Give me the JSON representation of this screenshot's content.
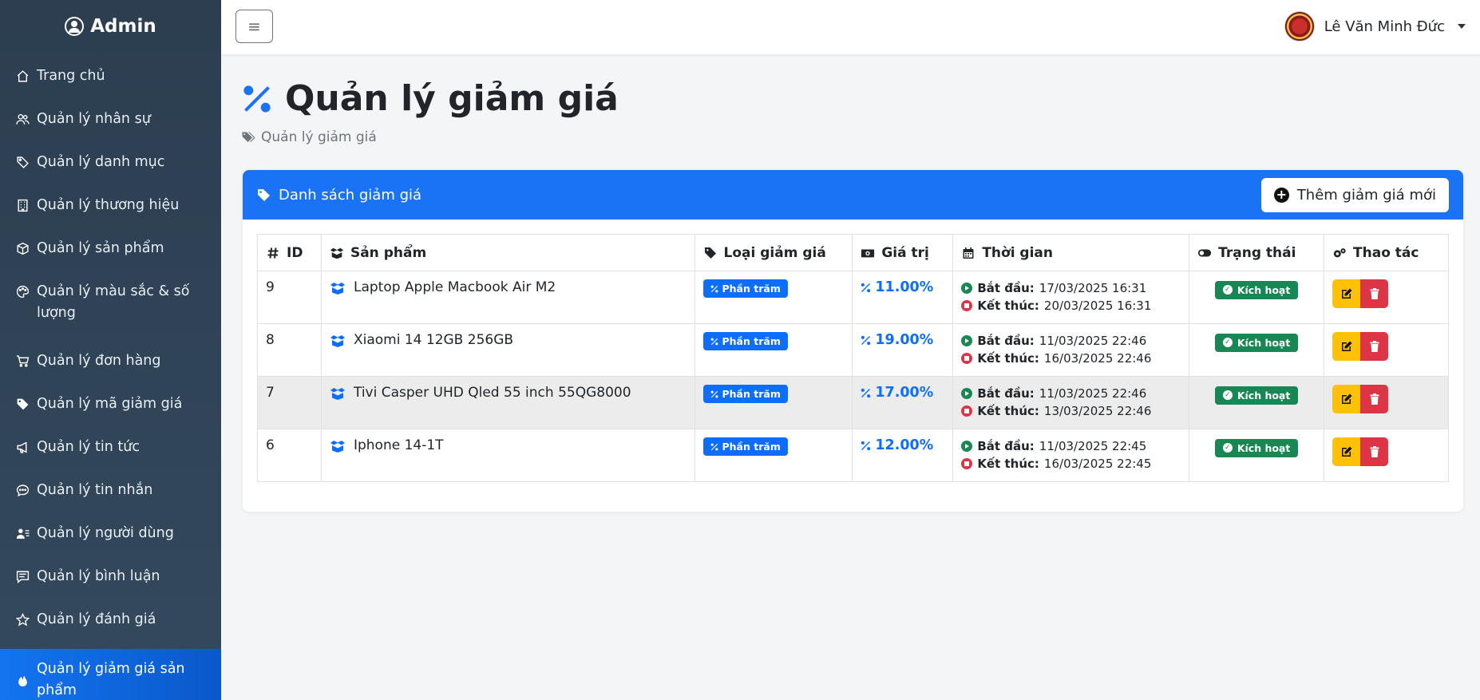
{
  "sidebar": {
    "brand": "Admin",
    "items": [
      {
        "label": "Trang chủ"
      },
      {
        "label": "Quản lý nhân sự"
      },
      {
        "label": "Quản lý danh mục"
      },
      {
        "label": "Quản lý thương hiệu"
      },
      {
        "label": "Quản lý sản phẩm"
      },
      {
        "label": "Quản lý màu sắc & số lượng"
      },
      {
        "label": "Quản lý đơn hàng"
      },
      {
        "label": "Quản lý mã giảm giá"
      },
      {
        "label": "Quản lý tin tức"
      },
      {
        "label": "Quản lý tin nhắn"
      },
      {
        "label": "Quản lý người dùng"
      },
      {
        "label": "Quản lý bình luận"
      },
      {
        "label": "Quản lý đánh giá"
      },
      {
        "label": "Quản lý giảm giá sản phẩm"
      }
    ],
    "active_index": 13
  },
  "header": {
    "toggle_label": "≡",
    "user_name": "Lê Văn Minh Đức"
  },
  "page": {
    "title": "Quản lý giảm giá",
    "breadcrumb": "Quản lý giảm giá"
  },
  "card": {
    "title": "Danh sách giảm giá",
    "add_button": "Thêm giảm giá mới"
  },
  "table": {
    "headers": {
      "id": "ID",
      "product": "Sản phẩm",
      "type": "Loại giảm giá",
      "value": "Giá trị",
      "time": "Thời gian",
      "status": "Trạng thái",
      "actions": "Thao tác"
    },
    "start_label": "Bắt đầu:",
    "end_label": "Kết thúc:",
    "rows": [
      {
        "id": "9",
        "product": "Laptop Apple Macbook Air M2",
        "type": "Phần trăm",
        "value": "11.00%",
        "start": "17/03/2025 16:31",
        "end": "20/03/2025 16:31",
        "status": "Kích hoạt"
      },
      {
        "id": "8",
        "product": "Xiaomi 14 12GB 256GB",
        "type": "Phần trăm",
        "value": "19.00%",
        "start": "11/03/2025 22:46",
        "end": "16/03/2025 22:46",
        "status": "Kích hoạt"
      },
      {
        "id": "7",
        "product": "Tivi Casper UHD Qled 55 inch 55QG8000",
        "type": "Phần trăm",
        "value": "17.00%",
        "start": "11/03/2025 22:46",
        "end": "13/03/2025 22:46",
        "status": "Kích hoạt"
      },
      {
        "id": "6",
        "product": "Iphone 14-1T",
        "type": "Phần trăm",
        "value": "12.00%",
        "start": "11/03/2025 22:45",
        "end": "16/03/2025 22:45",
        "status": "Kích hoạt"
      }
    ]
  },
  "colors": {
    "sidebar_bg": "#2c3e50",
    "primary": "#0d6efd",
    "success": "#198754",
    "warning": "#ffc107",
    "danger": "#dc3545"
  }
}
